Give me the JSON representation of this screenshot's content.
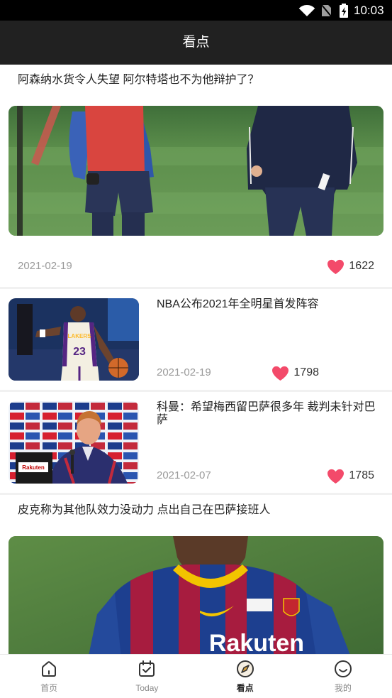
{
  "status_bar": {
    "time": "10:03",
    "icons": [
      "wifi-icon",
      "no-sim-icon",
      "battery-charging-icon"
    ]
  },
  "header": {
    "title": "看点"
  },
  "articles": [
    {
      "title": "阿森纳水货令人失望 阿尔特塔也不为他辩护了？",
      "date": "2021-02-19",
      "likes": 1622
    },
    {
      "title": "NBA公布2021年全明星首发阵容",
      "date": "2021-02-19",
      "likes": 1798,
      "photo_lettering": [
        "LAKERS",
        "23"
      ]
    },
    {
      "title": "科曼：希望梅西留巴萨很多年 裁判未针对巴萨",
      "date": "2021-02-07",
      "likes": 1785,
      "photo_lettering": [
        "Rakuten"
      ]
    },
    {
      "title": "皮克称为其他队效力没动力 点出自己在巴萨接班人",
      "photo_lettering": [
        "Rakuten"
      ]
    }
  ],
  "tab_bar": {
    "tabs": [
      {
        "label": "首页",
        "icon": "home-icon",
        "active": false
      },
      {
        "label": "Today",
        "icon": "calendar-check-icon",
        "active": false
      },
      {
        "label": "看点",
        "icon": "compass-icon",
        "active": true
      },
      {
        "label": "我的",
        "icon": "smile-icon",
        "active": false
      }
    ]
  },
  "colors": {
    "header_bg": "#212121",
    "like_heart": "#f34a6a",
    "active_tab_label": "#222222",
    "inactive_tab_label": "#888888"
  }
}
